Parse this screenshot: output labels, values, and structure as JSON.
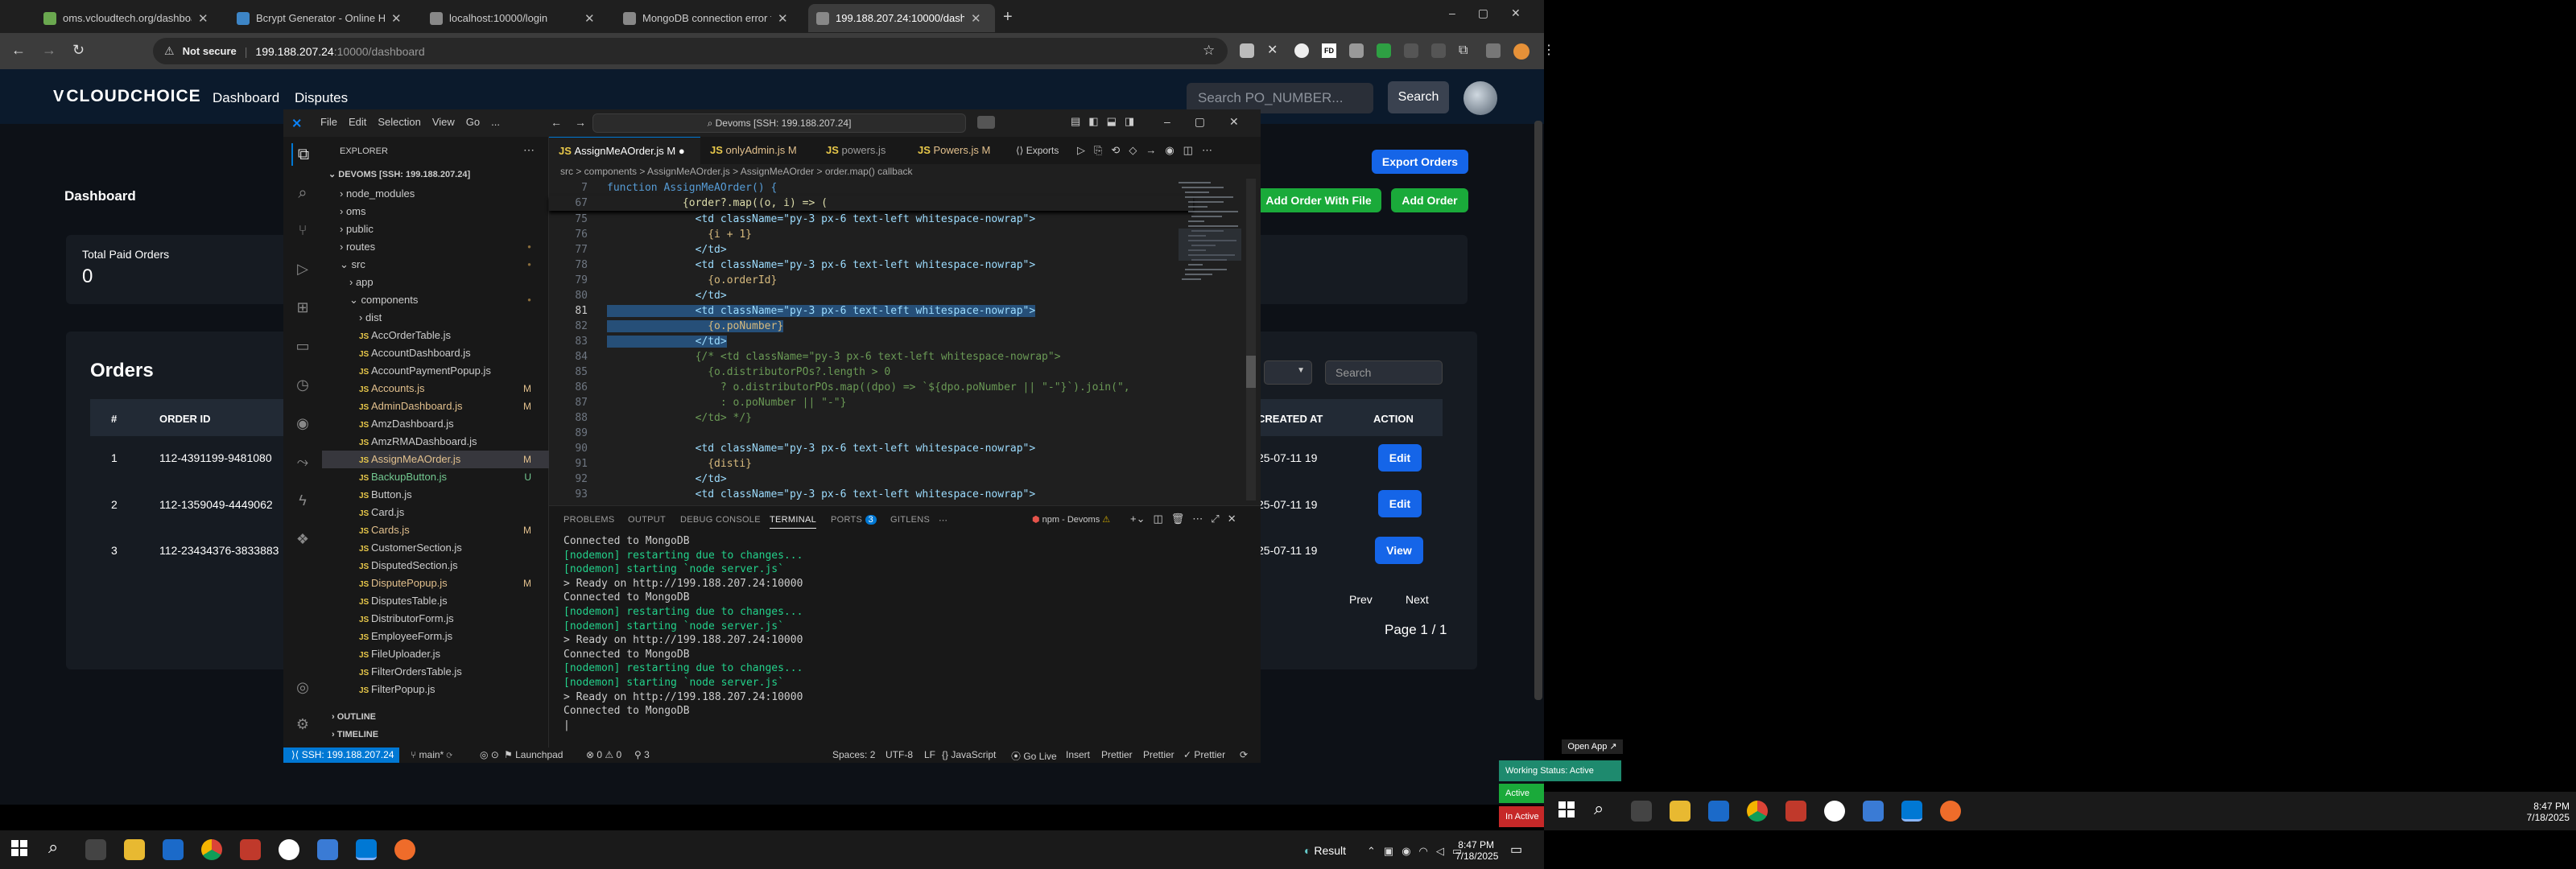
{
  "browser": {
    "tabs": [
      {
        "title": "oms.vcloudtech.org/dashboard",
        "color": "#6aa84f"
      },
      {
        "title": "Bcrypt Generator - Online Hash",
        "color": "#3d85c6"
      },
      {
        "title": "localhost:10000/login",
        "color": "#999999"
      },
      {
        "title": "MongoDB connection error fix",
        "color": "#999999"
      },
      {
        "title": "199.188.207.24:10000/dashboard",
        "color": "#999999"
      }
    ],
    "not_secure": "Not secure",
    "url_host": "199.188.207.24",
    "url_path": ":10000/dashboard"
  },
  "webapp": {
    "logo": "CLOUDCHOICE",
    "nav": [
      "Dashboard",
      "Disputes"
    ],
    "search_placeholder": "Search PO_NUMBER...",
    "search_button": "Search",
    "page_title": "Dashboard",
    "paid_orders_label": "Total Paid Orders",
    "paid_orders_value": "0",
    "export_button": "Export Orders",
    "add_with_file_button": "Add Order With File",
    "add_order_button": "Add Order",
    "orders_title": "Orders",
    "filter_search_placeholder": "Search",
    "columns": [
      "#",
      "ORDER ID",
      "CREATED AT",
      "ACTION"
    ],
    "rows": [
      {
        "n": "1",
        "order_id": "112-4391199-9481080",
        "created": "25-07-11 19",
        "action": "Edit"
      },
      {
        "n": "2",
        "order_id": "112-1359049-4449062",
        "created": "25-07-11 19",
        "action": "Edit"
      },
      {
        "n": "3",
        "order_id": "112-23434376-3833883",
        "created": "25-07-11 19",
        "action": "View"
      }
    ],
    "prev": "Prev",
    "next": "Next",
    "page_info": "Page 1 / 1"
  },
  "vscode": {
    "menu": [
      "File",
      "Edit",
      "Selection",
      "View",
      "Go",
      "..."
    ],
    "command_center": "Devoms [SSH: 199.188.207.24]",
    "explorer_title": "EXPLORER",
    "workspace": "DEVOMS [SSH: 199.188.207.24]",
    "tree": [
      {
        "name": "node_modules",
        "indent": 1,
        "type": "folder",
        "open": false,
        "status": ""
      },
      {
        "name": "oms",
        "indent": 1,
        "type": "folder",
        "open": false,
        "status": ""
      },
      {
        "name": "public",
        "indent": 1,
        "type": "folder",
        "open": false,
        "status": ""
      },
      {
        "name": "routes",
        "indent": 1,
        "type": "folder",
        "open": false,
        "status": "dot"
      },
      {
        "name": "src",
        "indent": 1,
        "type": "folder",
        "open": true,
        "status": "dot"
      },
      {
        "name": "app",
        "indent": 2,
        "type": "folder",
        "open": false,
        "status": ""
      },
      {
        "name": "components",
        "indent": 2,
        "type": "folder",
        "open": true,
        "status": "dot"
      },
      {
        "name": "dist",
        "indent": 3,
        "type": "folder",
        "open": false,
        "status": ""
      },
      {
        "name": "AccOrderTable.js",
        "indent": 3,
        "type": "js",
        "status": ""
      },
      {
        "name": "AccountDashboard.js",
        "indent": 3,
        "type": "js",
        "status": ""
      },
      {
        "name": "AccountPaymentPopup.js",
        "indent": 3,
        "type": "js",
        "status": ""
      },
      {
        "name": "Accounts.js",
        "indent": 3,
        "type": "js",
        "status": "M"
      },
      {
        "name": "AdminDashboard.js",
        "indent": 3,
        "type": "js",
        "status": "M"
      },
      {
        "name": "AmzDashboard.js",
        "indent": 3,
        "type": "js",
        "status": ""
      },
      {
        "name": "AmzRMADashboard.js",
        "indent": 3,
        "type": "js",
        "status": ""
      },
      {
        "name": "AssignMeAOrder.js",
        "indent": 3,
        "type": "js",
        "status": "M",
        "selected": true
      },
      {
        "name": "BackupButton.js",
        "indent": 3,
        "type": "js",
        "status": "U"
      },
      {
        "name": "Button.js",
        "indent": 3,
        "type": "js",
        "status": ""
      },
      {
        "name": "Card.js",
        "indent": 3,
        "type": "js",
        "status": ""
      },
      {
        "name": "Cards.js",
        "indent": 3,
        "type": "js",
        "status": "M"
      },
      {
        "name": "CustomerSection.js",
        "indent": 3,
        "type": "js",
        "status": ""
      },
      {
        "name": "DisputedSection.js",
        "indent": 3,
        "type": "js",
        "status": ""
      },
      {
        "name": "DisputePopup.js",
        "indent": 3,
        "type": "js",
        "status": "M"
      },
      {
        "name": "DisputesTable.js",
        "indent": 3,
        "type": "js",
        "status": ""
      },
      {
        "name": "DistributorForm.js",
        "indent": 3,
        "type": "js",
        "status": ""
      },
      {
        "name": "EmployeeForm.js",
        "indent": 3,
        "type": "js",
        "status": ""
      },
      {
        "name": "FileUploader.js",
        "indent": 3,
        "type": "js",
        "status": ""
      },
      {
        "name": "FilterOrdersTable.js",
        "indent": 3,
        "type": "js",
        "status": ""
      },
      {
        "name": "FilterPopup.js",
        "indent": 3,
        "type": "js",
        "status": ""
      }
    ],
    "outline": "OUTLINE",
    "timeline": "TIMELINE",
    "editor_tabs": [
      {
        "label": "AssignMeAOrder.js",
        "flag": "M",
        "active": true
      },
      {
        "label": "onlyAdmin.js",
        "flag": "M",
        "active": false
      },
      {
        "label": "powers.js",
        "flag": "",
        "active": false
      },
      {
        "label": "Powers.js",
        "flag": "M",
        "active": false
      }
    ],
    "breadcrumb": "src > components > AssignMeAOrder.js > AssignMeAOrder > order.map() callback",
    "sticky": [
      {
        "n": "7",
        "text": "function AssignMeAOrder() {"
      },
      {
        "n": "67",
        "text": "            {order?.map((o, i) => ("
      }
    ],
    "code": [
      {
        "n": "75",
        "text": "              <td className=\"py-3 px-6 text-left whitespace-nowrap\">"
      },
      {
        "n": "76",
        "text": "                {i + 1}"
      },
      {
        "n": "77",
        "text": "              </td>"
      },
      {
        "n": "78",
        "text": "              <td className=\"py-3 px-6 text-left whitespace-nowrap\">"
      },
      {
        "n": "79",
        "text": "                {o.orderId}"
      },
      {
        "n": "80",
        "text": "              </td>"
      },
      {
        "n": "81",
        "text": "              <td className=\"py-3 px-6 text-left whitespace-nowrap\">"
      },
      {
        "n": "82",
        "text": "                {o.poNumber}"
      },
      {
        "n": "83",
        "text": "              </td>"
      },
      {
        "n": "84",
        "text": "              {/* <td className=\"py-3 px-6 text-left whitespace-nowrap\">"
      },
      {
        "n": "85",
        "text": "                {o.distributorPOs?.length > 0"
      },
      {
        "n": "86",
        "text": "                  ? o.distributorPOs.map((dpo) => `${dpo.poNumber || \"-\"}`).join(\","
      },
      {
        "n": "87",
        "text": "                  : o.poNumber || \"-\"}"
      },
      {
        "n": "88",
        "text": "              </td> */}"
      },
      {
        "n": "89",
        "text": ""
      },
      {
        "n": "90",
        "text": "              <td className=\"py-3 px-6 text-left whitespace-nowrap\">"
      },
      {
        "n": "91",
        "text": "                {disti}"
      },
      {
        "n": "92",
        "text": "              </td>"
      },
      {
        "n": "93",
        "text": "              <td className=\"py-3 px-6 text-left whitespace-nowrap\">"
      }
    ],
    "panel_tabs": [
      "PROBLEMS",
      "OUTPUT",
      "DEBUG CONSOLE",
      "TERMINAL",
      "PORTS",
      "GITLENS"
    ],
    "ports_count": "3",
    "terminal_name": "npm - Devoms",
    "terminal": [
      {
        "t": "Connected to MongoDB",
        "g": false
      },
      {
        "t": "[nodemon] restarting due to changes...",
        "g": true
      },
      {
        "t": "[nodemon] starting `node server.js`",
        "g": true
      },
      {
        "t": "> Ready on http://199.188.207.24:10000",
        "g": false
      },
      {
        "t": "Connected to MongoDB",
        "g": false
      },
      {
        "t": "[nodemon] restarting due to changes...",
        "g": true
      },
      {
        "t": "[nodemon] starting `node server.js`",
        "g": true
      },
      {
        "t": "> Ready on http://199.188.207.24:10000",
        "g": false
      },
      {
        "t": "Connected to MongoDB",
        "g": false
      },
      {
        "t": "[nodemon] restarting due to changes...",
        "g": true
      },
      {
        "t": "[nodemon] starting `node server.js`",
        "g": true
      },
      {
        "t": "> Ready on http://199.188.207.24:10000",
        "g": false
      },
      {
        "t": "Connected to MongoDB",
        "g": false
      },
      {
        "t": "|",
        "g": false
      }
    ],
    "status": {
      "remote": "SSH: 199.188.207.24",
      "branch": "main*",
      "launchpad": "Launchpad",
      "problems": "⊗ 0 ⚠ 0",
      "ports": "3",
      "spaces": "Spaces: 2",
      "encoding": "UTF-8",
      "eol": "LF",
      "language": "JavaScript",
      "golive": "Go Live",
      "insert": "Insert",
      "prettier1": "Prettier",
      "prettier2": "Prettier",
      "prettier3": "✓ Prettier"
    }
  },
  "taskbar_left": {
    "result_label": "Result",
    "time": "8:47 PM",
    "date": "7/18/2025"
  },
  "taskbar_right": {
    "time": "8:47 PM",
    "date": "7/18/2025"
  },
  "tray_popup": {
    "open_app": "Open App ↗",
    "working": "Working Status: Active",
    "active": "Active",
    "in_active": "In Active"
  }
}
